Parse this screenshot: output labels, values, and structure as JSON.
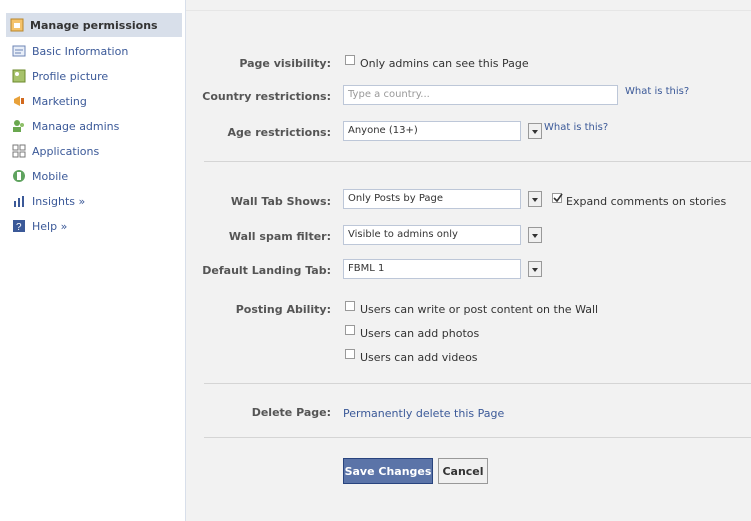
{
  "sidebar": {
    "items": [
      {
        "label": "Manage permissions",
        "icon": "lock-icon"
      },
      {
        "label": "Basic Information",
        "icon": "info-card-icon"
      },
      {
        "label": "Profile picture",
        "icon": "picture-icon"
      },
      {
        "label": "Marketing",
        "icon": "megaphone-icon"
      },
      {
        "label": "Manage admins",
        "icon": "admins-icon"
      },
      {
        "label": "Applications",
        "icon": "puzzle-icon"
      },
      {
        "label": "Mobile",
        "icon": "mobile-icon"
      },
      {
        "label": "Insights »",
        "icon": "chart-icon"
      },
      {
        "label": "Help »",
        "icon": "help-icon"
      }
    ]
  },
  "form": {
    "page_visibility": {
      "label": "Page visibility:",
      "option": "Only admins can see this Page"
    },
    "country_restrictions": {
      "label": "Country restrictions:",
      "placeholder": "Type a country...",
      "help": "What is this?"
    },
    "age_restrictions": {
      "label": "Age restrictions:",
      "value": "Anyone (13+)",
      "help": "What is this?"
    },
    "wall_tab": {
      "label": "Wall Tab Shows:",
      "value": "Only Posts by Page",
      "expand_label": "Expand comments on stories",
      "expand_checked": true
    },
    "wall_spam": {
      "label": "Wall spam filter:",
      "value": "Visible to admins only"
    },
    "landing_tab": {
      "label": "Default Landing Tab:",
      "value": "FBML 1"
    },
    "posting_ability": {
      "label": "Posting Ability:",
      "options": [
        "Users can write or post content on the Wall",
        "Users can add photos",
        "Users can add videos"
      ]
    },
    "delete_page": {
      "label": "Delete Page:",
      "link": "Permanently delete this Page"
    }
  },
  "buttons": {
    "save": "Save Changes",
    "cancel": "Cancel"
  },
  "colors": {
    "link": "#3b5998",
    "save_bg": "#5b74a8",
    "active_bg": "#d8dfea",
    "main_bg": "#f2f2f2"
  }
}
